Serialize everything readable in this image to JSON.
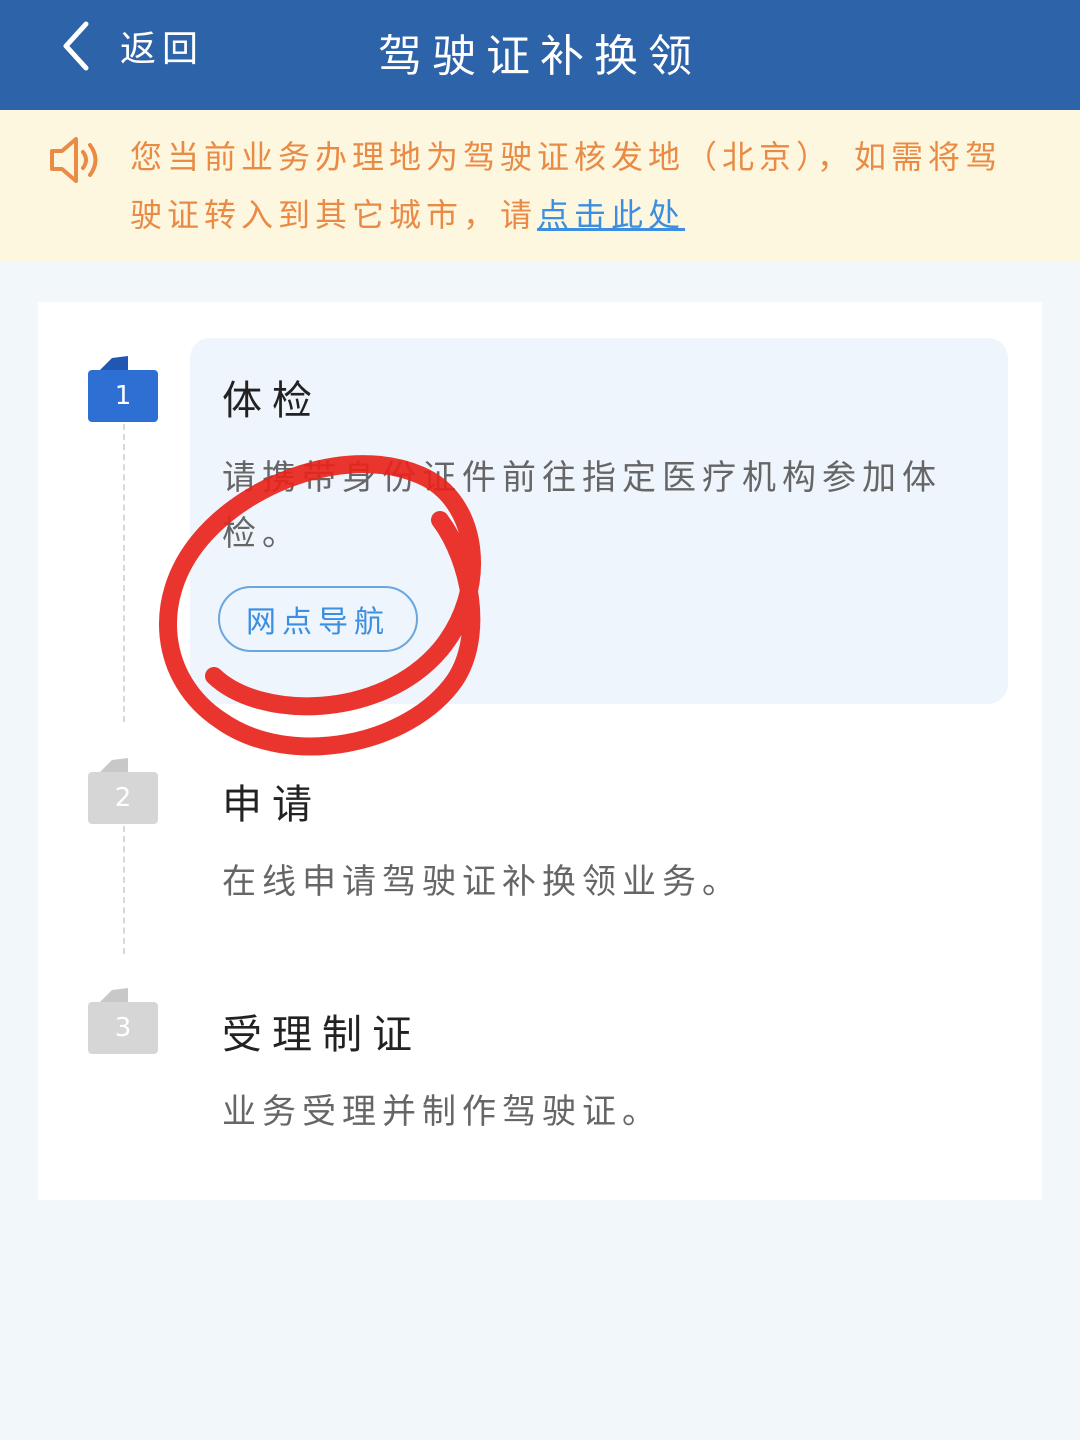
{
  "header": {
    "back_label": "返回",
    "title": "驾驶证补换领"
  },
  "notice": {
    "icon": "speaker-icon",
    "text": "您当前业务办理地为驾驶证核发地（北京），如需将驾驶证转入到其它城市，请",
    "link_text": "点击此处"
  },
  "steps": [
    {
      "number": "1",
      "title": "体检",
      "description": "请携带身份证件前往指定医疗机构参加体检。",
      "button_label": "网点导航",
      "active": true
    },
    {
      "number": "2",
      "title": "申请",
      "description": "在线申请驾驶证补换领业务。",
      "active": false
    },
    {
      "number": "3",
      "title": "受理制证",
      "description": "业务受理并制作驾驶证。",
      "active": false
    }
  ],
  "colors": {
    "header_bg": "#2d63a8",
    "notice_bg": "#fdf7df",
    "notice_text": "#e98a45",
    "link": "#3b8ee0",
    "active_step": "#2d6fd2",
    "inactive_step": "#d6d6d6",
    "annotation": "#e8241c"
  }
}
